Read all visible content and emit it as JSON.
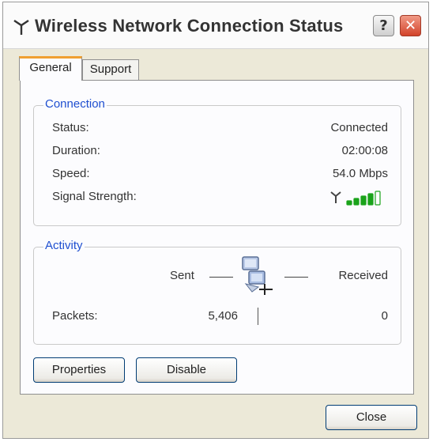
{
  "window": {
    "title": "Wireless Network Connection Status",
    "help_label": "?",
    "close_glyph": "✕"
  },
  "tabs": [
    {
      "label": "General",
      "selected": true
    },
    {
      "label": "Support",
      "selected": false
    }
  ],
  "connection": {
    "legend": "Connection",
    "status_label": "Status:",
    "status_value": "Connected",
    "duration_label": "Duration:",
    "duration_value": "02:00:08",
    "speed_label": "Speed:",
    "speed_value": "54.0 Mbps",
    "signal_label": "Signal Strength:",
    "signal_bars_lit": 4,
    "signal_bars_total": 5
  },
  "activity": {
    "legend": "Activity",
    "sent_label": "Sent",
    "received_label": "Received",
    "packets_label": "Packets:",
    "packets_sent": "5,406",
    "packets_received": "0"
  },
  "buttons": {
    "properties": "Properties",
    "disable": "Disable",
    "close": "Close"
  },
  "colors": {
    "accent_blue": "#1f4fd0",
    "signal_green": "#1aa31a",
    "tab_highlight": "#f0a030"
  }
}
